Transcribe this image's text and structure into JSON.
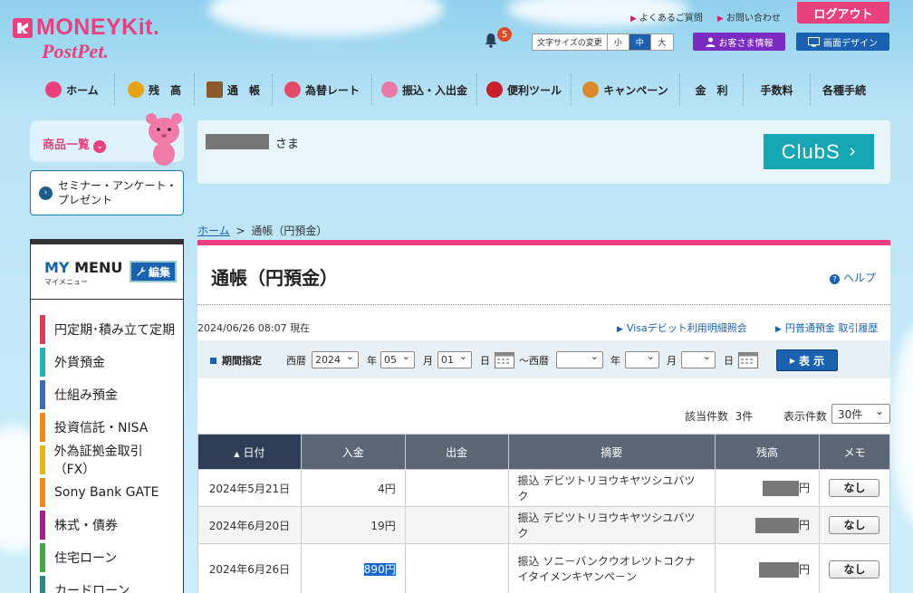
{
  "header": {
    "brand": "MONEYKit.",
    "brand_sub": "PostPet.",
    "faq": "よくあるご質問",
    "contact": "お問い合わせ",
    "logout": "ログアウト",
    "notification_count": "5",
    "font_size_label": "文字サイズの変更",
    "font_sizes": [
      "小",
      "中",
      "大"
    ],
    "font_size_selected": "中",
    "customer_info": "お客さま情報",
    "screen_design": "画面デザイン"
  },
  "nav": [
    "ホーム",
    "残　高",
    "通　帳",
    "為替レート",
    "振込・入出金",
    "便利ツール",
    "キャンペーン",
    "金　利",
    "手数料",
    "各種手続"
  ],
  "sidebar": {
    "products": "商品一覧",
    "seminar": "セミナー・アンケート・プレゼント",
    "mymenu_title": "MY",
    "mymenu_title2": "MENU",
    "mymenu_sub": "マイメニュー",
    "edit": "編集",
    "items": [
      {
        "label": "円定期･積み立て定期",
        "color": "#d8405a"
      },
      {
        "label": "外貨預金",
        "color": "#29b0b5"
      },
      {
        "label": "仕組み預金",
        "color": "#3a6fb5"
      },
      {
        "label": "投資信託・NISA",
        "color": "#f08a1c"
      },
      {
        "label": "外為証拠金取引（FX）",
        "color": "#e5b51a"
      },
      {
        "label": "Sony Bank GATE",
        "color": "#f08a1c"
      },
      {
        "label": "株式・債券",
        "color": "#a0218f"
      },
      {
        "label": "住宅ローン",
        "color": "#46a74a"
      },
      {
        "label": "カードローン",
        "color": "#2a8a86"
      }
    ]
  },
  "welcome": {
    "suffix": "さま",
    "clubs": "ClubS"
  },
  "breadcrumb": {
    "home": "ホーム",
    "sep": ">",
    "current": "通帳（円預金）"
  },
  "page": {
    "title": "通帳（円預金）",
    "help": "ヘルプ",
    "timestamp": "2024/06/26 08:07 現在",
    "link_visa": "Visaデビット利用明細照会",
    "link_history": "円普通預金 取引履歴"
  },
  "period": {
    "label": "期間指定",
    "era_from": "西暦",
    "year": "2024",
    "year_unit": "年",
    "month": "05",
    "month_unit": "月",
    "day": "01",
    "day_unit": "日",
    "tilde": "～西暦",
    "show": "表 示"
  },
  "results": {
    "count_label": "該当件数",
    "count": "3件",
    "per_page_label": "表示件数",
    "per_page": "30件"
  },
  "table": {
    "columns": [
      "日付",
      "入金",
      "出金",
      "摘要",
      "残高",
      "メモ"
    ],
    "rows": [
      {
        "date": "2024年5月21日",
        "deposit": "4円",
        "withdraw": "",
        "desc": "振込 デビツトリヨウキヤツシユバツク",
        "balance_suffix": "円",
        "memo": "なし"
      },
      {
        "date": "2024年6月20日",
        "deposit": "19円",
        "withdraw": "",
        "desc": "振込 デビツトリヨウキヤツシユバツク",
        "balance_suffix": "円",
        "memo": "なし"
      },
      {
        "date": "2024年6月26日",
        "deposit": "890円",
        "withdraw": "",
        "desc": "振込 ソニ－バンクウオレツトコクナイタイメンキヤンペ－ン",
        "balance_suffix": "円",
        "memo": "なし"
      }
    ]
  }
}
